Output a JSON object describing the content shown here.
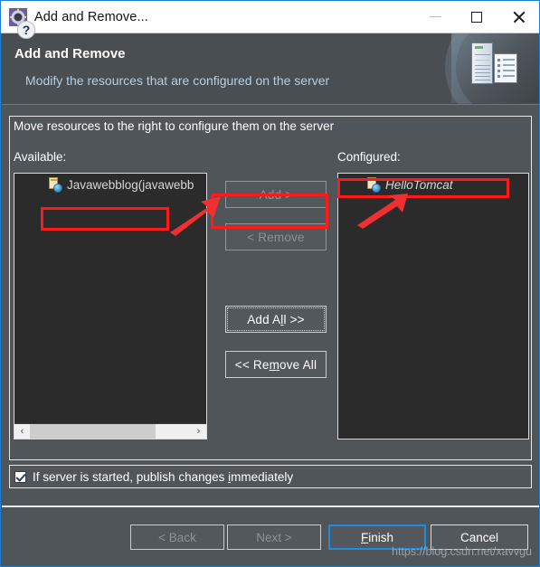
{
  "window": {
    "title": "Add and Remove...",
    "icon": "eclipse-wizard-icon",
    "minimize_label": "—",
    "maximize_label": "□",
    "close_label": "✕"
  },
  "header": {
    "title": "Add and Remove",
    "subtitle": "Modify the resources that are configured on the server",
    "art": "server-and-document-illustration"
  },
  "panel": {
    "instruction": "Move resources to the right to configure them on the server",
    "available_label": "Available:",
    "configured_label": "Configured:"
  },
  "available_list": {
    "items": [
      {
        "label": "Javawebblog(javawebb",
        "icon": "web-module-icon"
      }
    ],
    "scrollbar": {
      "left_arrow": "‹",
      "right_arrow": "›"
    }
  },
  "configured_list": {
    "items": [
      {
        "label": "HelloTomcat",
        "icon": "web-module-icon"
      }
    ]
  },
  "transfer_buttons": [
    {
      "label": "Add >",
      "enabled": false,
      "name": "add-button"
    },
    {
      "label": "< Remove",
      "enabled": false,
      "name": "remove-button"
    },
    {
      "label": "Add All >>",
      "enabled": true,
      "name": "add-all-button"
    },
    {
      "label": "<< Remove All",
      "enabled": true,
      "name": "remove-all-button"
    }
  ],
  "publish_option": {
    "label": "If server is started, publish changes immediately",
    "checked": true
  },
  "footer": {
    "help_label": "?",
    "back_label": "< Back",
    "next_label": "Next >",
    "finish_label": "Finish",
    "cancel_label": "Cancel",
    "watermark": "https://blog.csdn.net/xavvgu"
  },
  "annotations": {
    "accent_color": "#ff1a1a",
    "highlight_empty_area": "empty-available-area",
    "highlight_add_button": "add-button",
    "highlight_configured_item": "HelloTomcat"
  }
}
